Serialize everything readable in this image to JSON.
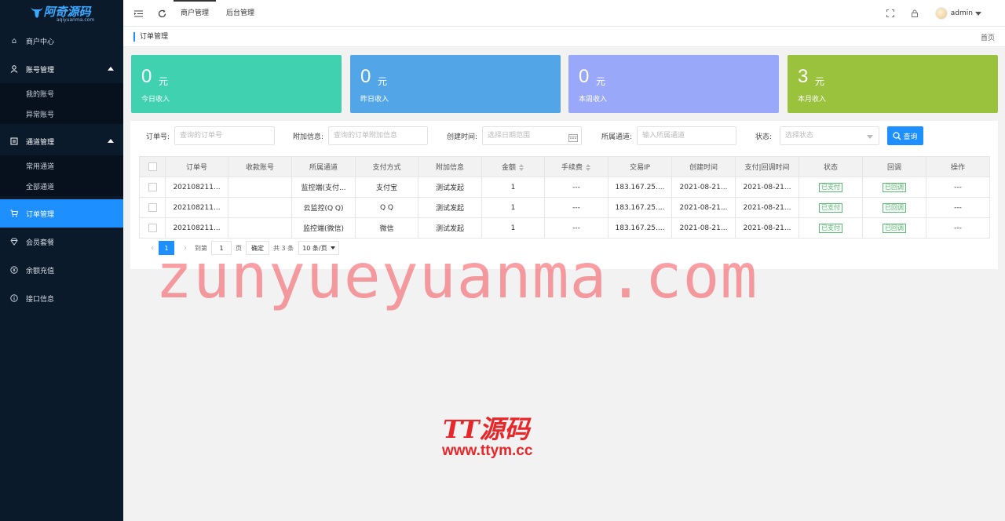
{
  "logo": {
    "title": "阿奇源码",
    "subtitle": "aqiyuanma.com"
  },
  "sidebar": {
    "items": [
      {
        "label": "商户中心"
      },
      {
        "label": "账号管理",
        "children": [
          "我的账号",
          "异常账号"
        ]
      },
      {
        "label": "通道管理",
        "children": [
          "常用通道",
          "全部通道"
        ]
      },
      {
        "label": "订单管理"
      },
      {
        "label": "会员套餐"
      },
      {
        "label": "余额充值"
      },
      {
        "label": "接口信息"
      }
    ]
  },
  "topbar": {
    "tabs": [
      "商户管理",
      "后台管理"
    ],
    "user": "admin"
  },
  "breadcrumb": {
    "current": "订单管理",
    "home": "首页"
  },
  "stats": [
    {
      "value": "0",
      "unit": "元",
      "label": "今日收入",
      "color": "#40d2b0"
    },
    {
      "value": "0",
      "unit": "元",
      "label": "昨日收入",
      "color": "#52a6e7"
    },
    {
      "value": "0",
      "unit": "元",
      "label": "本周收入",
      "color": "#9aa8fa"
    },
    {
      "value": "3",
      "unit": "元",
      "label": "本月收入",
      "color": "#9ac23d"
    }
  ],
  "filters": {
    "order_no": {
      "label": "订单号:",
      "placeholder": "查询的订单号"
    },
    "extra": {
      "label": "附加信息:",
      "placeholder": "查询的订单附加信息"
    },
    "created": {
      "label": "创建时间:",
      "placeholder": "选择日期范围"
    },
    "channel": {
      "label": "所属通道:",
      "placeholder": "输入所属通道"
    },
    "status": {
      "label": "状态:",
      "placeholder": "选择状态"
    },
    "search_button": "查询"
  },
  "table": {
    "headers": [
      "订单号",
      "收款账号",
      "所属通道",
      "支付方式",
      "附加信息",
      "金额",
      "手续费",
      "交易IP",
      "创建时间",
      "支付|回调时间",
      "状态",
      "回调",
      "操作"
    ],
    "rows": [
      {
        "order_no": "202108211...",
        "account": "",
        "channel": "监控端(支付...",
        "pay_method": "支付宝",
        "extra": "测试发起",
        "amount": "1",
        "fee": "---",
        "ip": "183.167.25....",
        "created": "2021-08-21...",
        "paid": "2021-08-21...",
        "status": "已支付",
        "callback": "已回调",
        "op": "---"
      },
      {
        "order_no": "202108211...",
        "account": "",
        "channel": "云监控(Q Q)",
        "pay_method": "Q Q",
        "extra": "测试发起",
        "amount": "1",
        "fee": "---",
        "ip": "183.167.25....",
        "created": "2021-08-21...",
        "paid": "2021-08-21...",
        "status": "已支付",
        "callback": "已回调",
        "op": "---"
      },
      {
        "order_no": "202108211...",
        "account": "",
        "channel": "监控端(微信)",
        "pay_method": "微信",
        "extra": "测试发起",
        "amount": "1",
        "fee": "---",
        "ip": "183.167.25....",
        "created": "2021-08-21...",
        "paid": "2021-08-21...",
        "status": "已支付",
        "callback": "已回调",
        "op": "---"
      }
    ]
  },
  "pager": {
    "prev": "‹",
    "current": "1",
    "next": "›",
    "goto_label": "到第",
    "goto_value": "1",
    "page_label": "页",
    "confirm": "确定",
    "total": "共 3 条",
    "page_size": "10 条/页"
  },
  "watermarks": {
    "main": "zunyueyuanma.com",
    "brand": "TT源码",
    "url": "www.ttym.cc"
  }
}
